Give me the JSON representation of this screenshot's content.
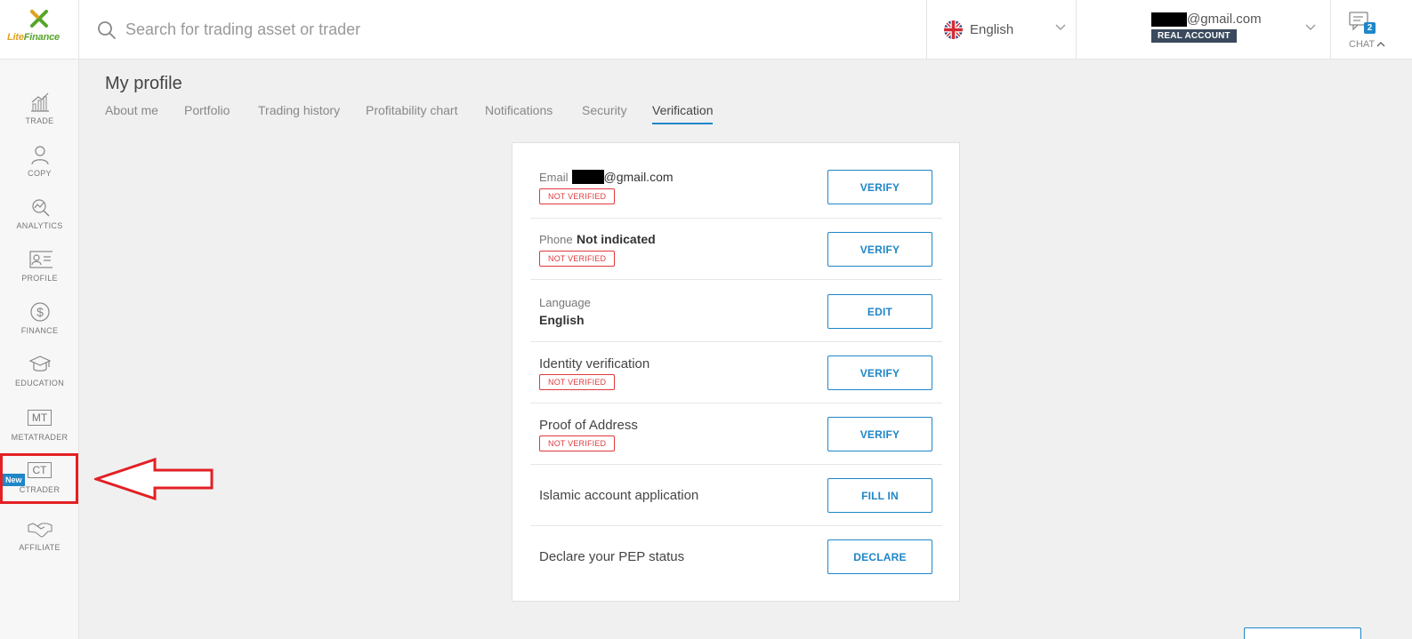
{
  "brand": {
    "name_lite": "Lite",
    "name_finance": "Finance",
    "primary_color": "#57a52b",
    "accent_color": "#1f86c8"
  },
  "search": {
    "placeholder": "Search for trading asset or trader"
  },
  "language_selector": {
    "value": "English",
    "flag": "uk-flag-icon"
  },
  "account": {
    "email_suffix": "@gmail.com",
    "badge": "REAL ACCOUNT"
  },
  "chat": {
    "label": "CHAT",
    "count": "2"
  },
  "sidebar": {
    "items": [
      {
        "label": "TRADE",
        "icon": "chart-icon"
      },
      {
        "label": "COPY",
        "icon": "person-icon"
      },
      {
        "label": "ANALYTICS",
        "icon": "analytics-icon"
      },
      {
        "label": "PROFILE",
        "icon": "id-card-icon"
      },
      {
        "label": "FINANCE",
        "icon": "dollar-icon"
      },
      {
        "label": "EDUCATION",
        "icon": "graduation-cap-icon"
      },
      {
        "label": "METATRADER",
        "icon_text": "MT"
      },
      {
        "label": "CTRADER",
        "icon_text": "CT",
        "badge": "New"
      },
      {
        "label": "AFFILIATE",
        "icon": "handshake-icon"
      }
    ]
  },
  "page": {
    "title": "My profile",
    "tabs": [
      "About me",
      "Portfolio",
      "Trading history",
      "Profitability chart",
      "Notifications",
      "Security",
      "Verification"
    ],
    "active_tab": "Verification"
  },
  "verification": {
    "not_verified_label": "NOT VERIFIED",
    "rows": [
      {
        "label": "Email",
        "value": "@gmail.com",
        "button": "VERIFY"
      },
      {
        "label": "Phone",
        "value": "Not indicated",
        "button": "VERIFY"
      },
      {
        "label": "Language",
        "value": "English",
        "button": "EDIT"
      },
      {
        "label": "Identity verification",
        "button": "VERIFY"
      },
      {
        "label": "Proof of Address",
        "button": "VERIFY"
      },
      {
        "label": "Islamic account application",
        "button": "FILL IN"
      },
      {
        "label": "Declare your PEP status",
        "button": "DECLARE"
      }
    ]
  }
}
